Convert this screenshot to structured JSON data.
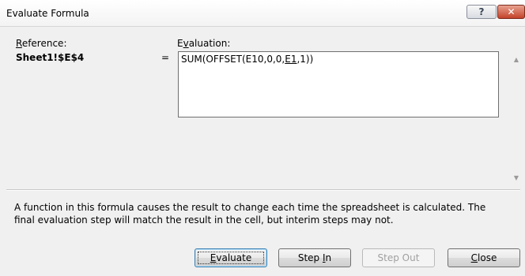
{
  "window": {
    "title": "Evaluate Formula",
    "help_glyph": "?",
    "close_glyph": "✕"
  },
  "reference": {
    "label_prefix": "R",
    "label_rest": "eference:",
    "value": "Sheet1!$E$4"
  },
  "equals": "=",
  "evaluation": {
    "label_prefix": "E",
    "label_mnemonic": "v",
    "label_rest": "aluation:",
    "text_before": "SUM(OFFSET(E10,0,0,",
    "text_underlined": "E1",
    "text_after": ",1))"
  },
  "scrollbar": {
    "up_glyph": "▲",
    "down_glyph": "▼"
  },
  "message": "A function in this formula causes the result to change each time the spreadsheet is calculated.  The final evaluation step will match the result in the cell, but interim steps may not.",
  "buttons": {
    "evaluate": {
      "prefix": "",
      "mnemonic": "E",
      "rest": "valuate"
    },
    "step_in": {
      "prefix": "Step ",
      "mnemonic": "I",
      "rest": "n"
    },
    "step_out": {
      "prefix": "Step O",
      "mnemonic": "",
      "rest": "ut"
    },
    "close": {
      "prefix": "",
      "mnemonic": "C",
      "rest": "lose"
    }
  }
}
